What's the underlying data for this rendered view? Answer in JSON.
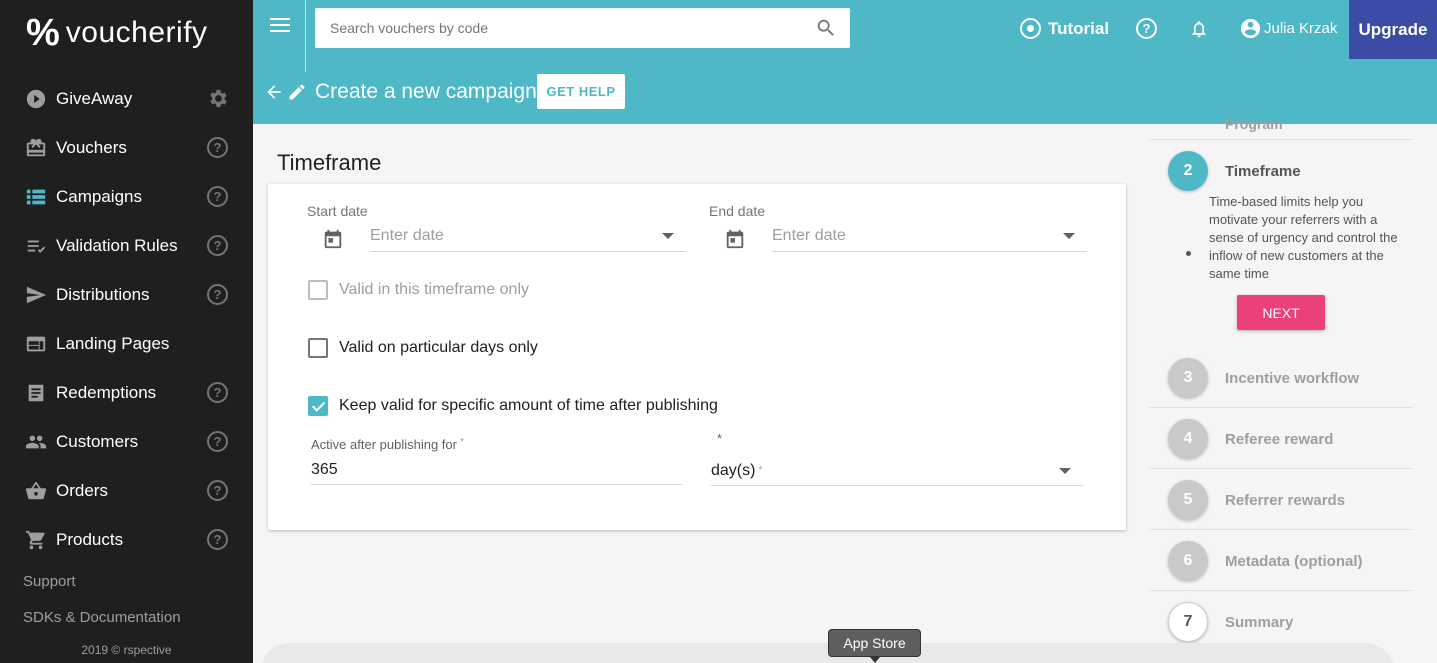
{
  "brand": {
    "name": "voucherify",
    "mark": "%"
  },
  "sidebar": {
    "items": [
      {
        "label": "GiveAway",
        "icon": "play-circle-icon",
        "trailing": "gear"
      },
      {
        "label": "Vouchers",
        "icon": "gift-card-icon",
        "trailing": "help"
      },
      {
        "label": "Campaigns",
        "icon": "list-icon",
        "trailing": "help"
      },
      {
        "label": "Validation Rules",
        "icon": "rules-icon",
        "trailing": "help"
      },
      {
        "label": "Distributions",
        "icon": "send-icon",
        "trailing": "help"
      },
      {
        "label": "Landing Pages",
        "icon": "web-icon",
        "trailing": ""
      },
      {
        "label": "Redemptions",
        "icon": "receipt-icon",
        "trailing": "help"
      },
      {
        "label": "Customers",
        "icon": "people-icon",
        "trailing": "help"
      },
      {
        "label": "Orders",
        "icon": "basket-icon",
        "trailing": "help"
      },
      {
        "label": "Products",
        "icon": "cart-icon",
        "trailing": "help"
      }
    ],
    "help_glyph": "?",
    "support": "Support",
    "sdks": "SDKs & Documentation",
    "copyright": "2019 © rspective"
  },
  "topbar": {
    "search_placeholder": "Search vouchers by code",
    "tutorial": "Tutorial",
    "help_glyph": "?",
    "user_name": "Julia Krzak",
    "upgrade": "Upgrade",
    "page_title": "Create a new campaign",
    "get_help": "GET HELP"
  },
  "form": {
    "section_title": "Timeframe",
    "start_date_label": "Start date",
    "start_date_placeholder": "Enter date",
    "end_date_label": "End date",
    "end_date_placeholder": "Enter date",
    "cb_timeframe": "Valid in this timeframe only",
    "cb_days": "Valid on particular days only",
    "cb_keep_valid": "Keep valid for specific amount of time after publishing",
    "active_after_label": "Active after publishing for",
    "active_after_value": "365",
    "unit_value": "day(s)",
    "required_mark": "*"
  },
  "stepper": {
    "prev_partial": "Program",
    "current": {
      "number": "2",
      "name": "Timeframe",
      "description": "Time-based limits help you motivate your referrers with a sense of urgency and control the inflow of new customers at the same time",
      "next": "NEXT"
    },
    "steps": [
      {
        "number": "3",
        "name": "Incentive workflow"
      },
      {
        "number": "4",
        "name": "Referee reward"
      },
      {
        "number": "5",
        "name": "Referrer rewards"
      },
      {
        "number": "6",
        "name": "Metadata (optional)"
      },
      {
        "number": "7",
        "name": "Summary"
      }
    ]
  },
  "footer": {
    "app_store": "App Store"
  },
  "colors": {
    "accent": "#4fb8c6",
    "upgrade": "#3b4ba6",
    "next": "#ec407a",
    "sidebar": "#1f1f1f"
  }
}
